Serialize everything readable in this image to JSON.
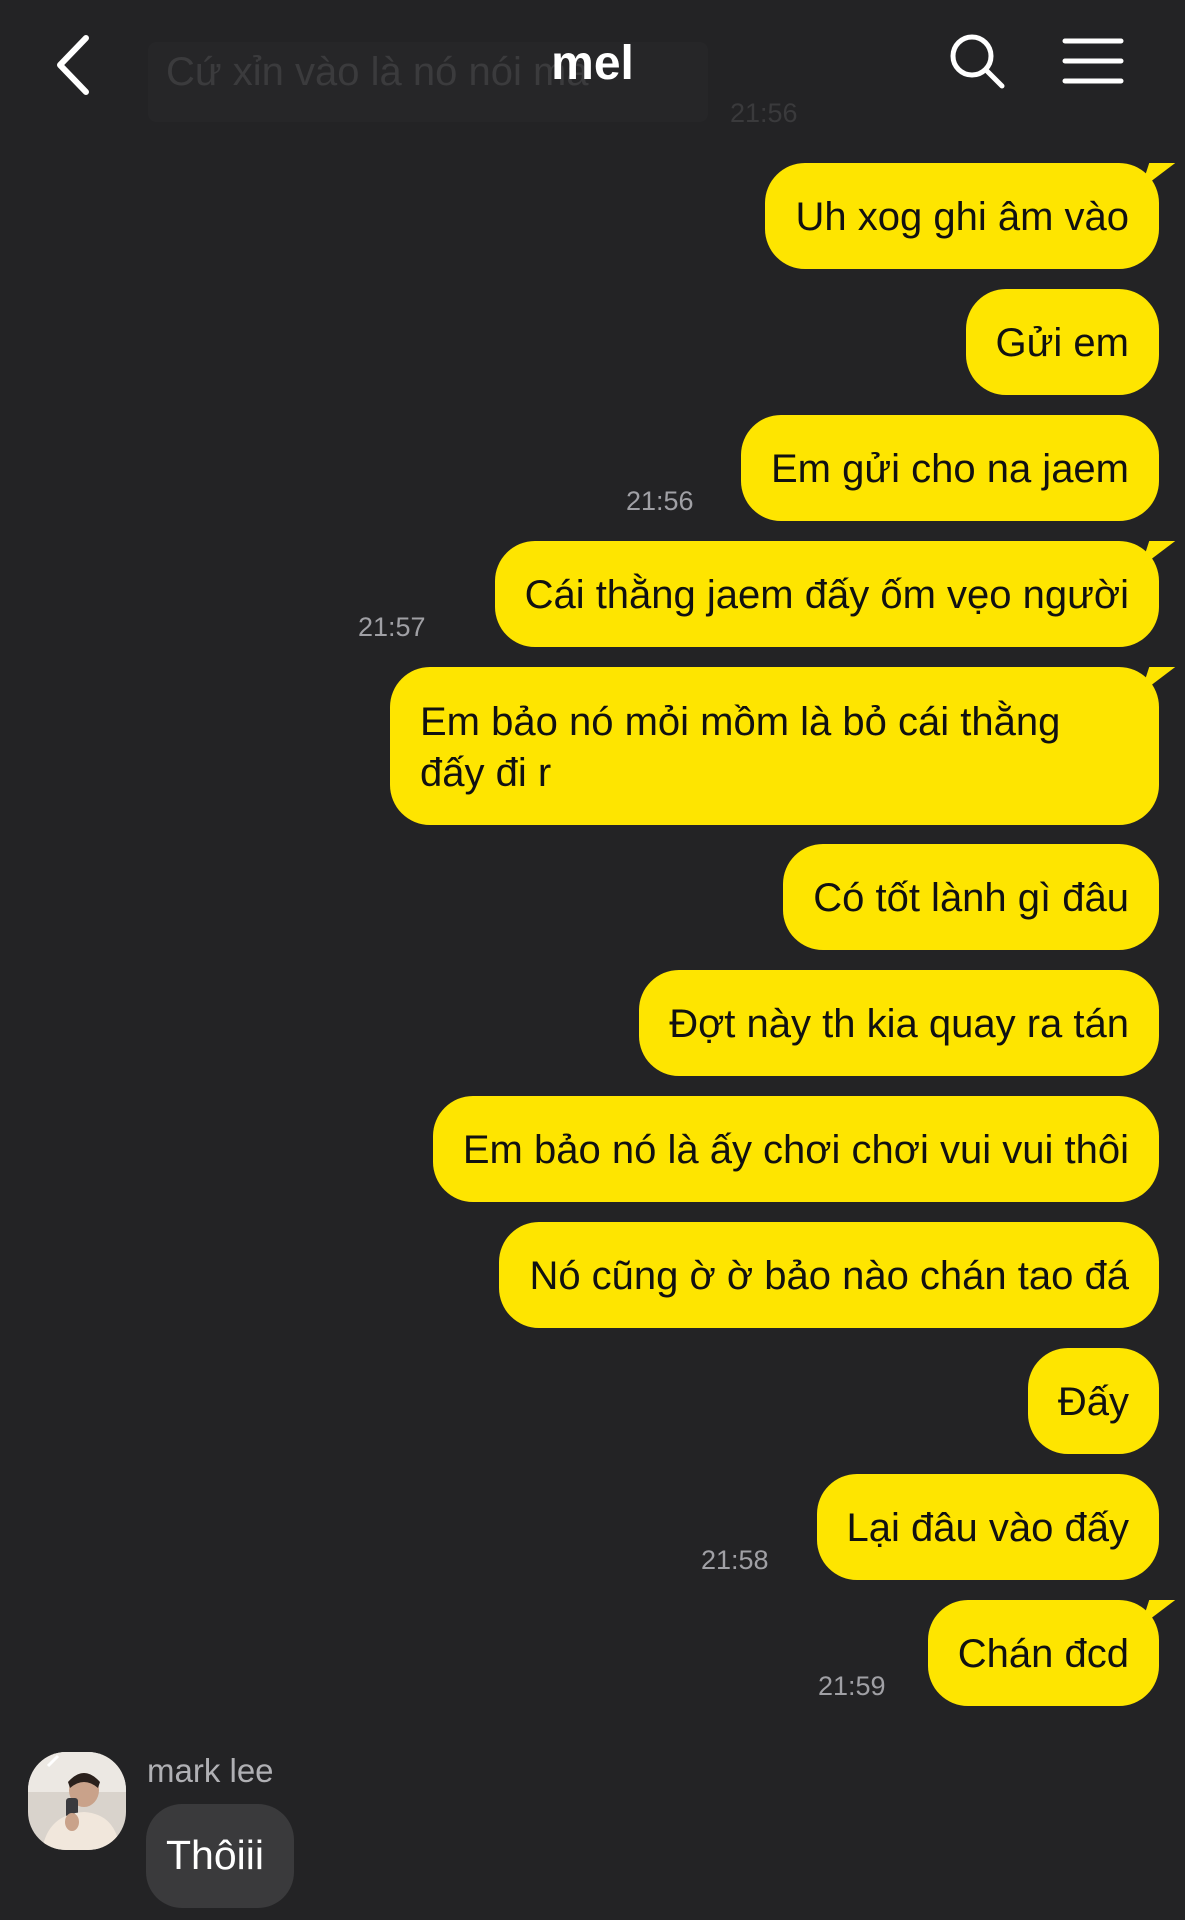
{
  "header": {
    "title": "mel",
    "back_icon": "chevron-left-icon",
    "search_icon": "search-icon",
    "menu_icon": "menu-icon"
  },
  "ghost_preview": {
    "text": "Cứ xỉn vào là nó nói mà",
    "time": "21:56"
  },
  "colors": {
    "background": "#232325",
    "outgoing_bubble": "#fee500",
    "incoming_bubble": "#3a3a3c"
  },
  "messages": [
    {
      "text": "Uh xog ghi âm vào",
      "time": ""
    },
    {
      "text": "Gửi em",
      "time": ""
    },
    {
      "text": "Em gửi cho na jaem",
      "time": "21:56"
    },
    {
      "text": "Cái thằng jaem đấy ốm vẹo người",
      "time": "21:57"
    },
    {
      "text": "Em bảo nó mỏi mồm là bỏ cái thằng đấy đi r",
      "time": ""
    },
    {
      "text": "Có tốt lành gì đâu",
      "time": ""
    },
    {
      "text": "Đợt này th kia quay ra tán",
      "time": ""
    },
    {
      "text": "Em bảo nó là ấy chơi chơi vui vui thôi",
      "time": ""
    },
    {
      "text": "Nó cũng ờ ờ bảo nào chán tao đá",
      "time": ""
    },
    {
      "text": "Đấy",
      "time": ""
    },
    {
      "text": "Lại đâu vào đấy",
      "time": "21:58"
    },
    {
      "text": "Chán đcd",
      "time": "21:59"
    }
  ],
  "incoming": {
    "sender": "mark lee",
    "text": "Thôiii",
    "avatar_icon": "avatar-photo"
  }
}
